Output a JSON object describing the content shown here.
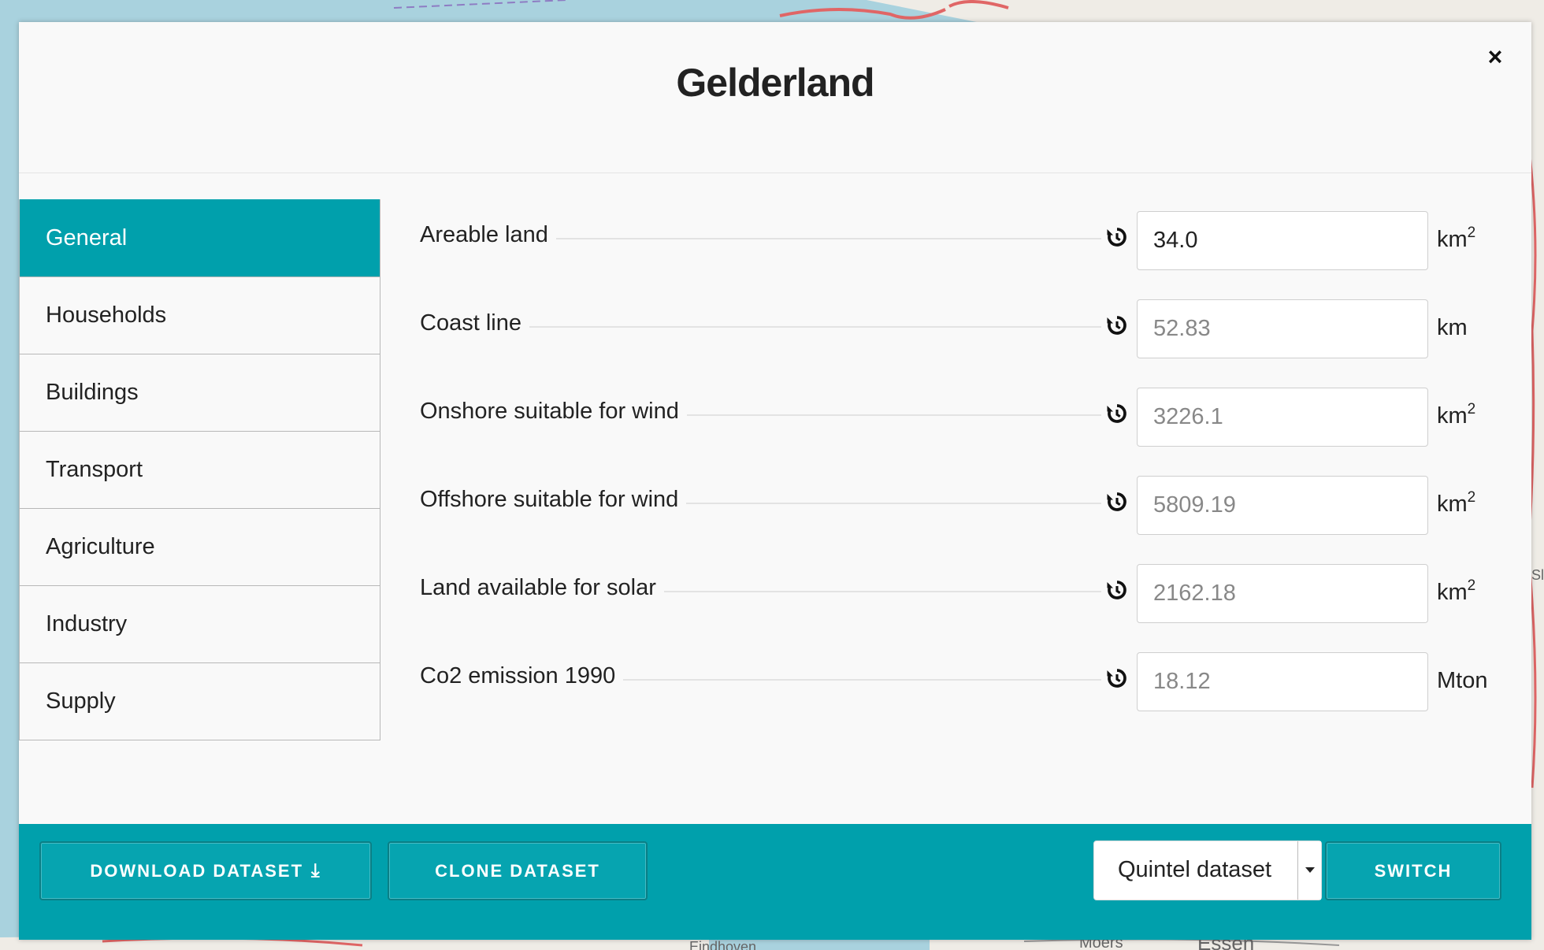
{
  "modal": {
    "title": "Gelderland",
    "close_label": "×"
  },
  "sidebar": {
    "items": [
      {
        "label": "General",
        "active": true
      },
      {
        "label": "Households"
      },
      {
        "label": "Buildings"
      },
      {
        "label": "Transport"
      },
      {
        "label": "Agriculture"
      },
      {
        "label": "Industry"
      },
      {
        "label": "Supply"
      }
    ]
  },
  "fields": [
    {
      "label": "Areable land",
      "value": "34.0",
      "unit": "km",
      "unit_sup": "2",
      "filled": true
    },
    {
      "label": "Coast line",
      "value": "52.83",
      "unit": "km",
      "unit_sup": ""
    },
    {
      "label": "Onshore suitable for wind",
      "value": "3226.1",
      "unit": "km",
      "unit_sup": "2"
    },
    {
      "label": "Offshore suitable for wind",
      "value": "5809.19",
      "unit": "km",
      "unit_sup": "2"
    },
    {
      "label": "Land available for solar",
      "value": "2162.18",
      "unit": "km",
      "unit_sup": "2"
    },
    {
      "label": "Co2 emission 1990",
      "value": "18.12",
      "unit": "Mton",
      "unit_sup": ""
    }
  ],
  "footer": {
    "download_label": "DOWNLOAD DATASET",
    "clone_label": "CLONE DATASET",
    "dataset_selected": "Quintel dataset",
    "switch_label": "SWITCH"
  },
  "map": {
    "labels": [
      "Moers",
      "Essen",
      "Eindhoven",
      "Sl"
    ]
  },
  "colors": {
    "accent": "#00a0ac",
    "map_water": "#a9d2de",
    "map_land": "#f2efe9",
    "map_border": "#e06666"
  }
}
